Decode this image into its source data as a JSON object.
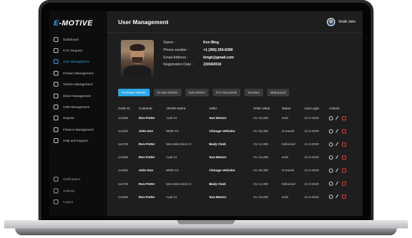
{
  "brand": {
    "prefix": "E",
    "name": "-MOTIVE"
  },
  "sidebar": {
    "items": [
      {
        "label": "Dashboard",
        "icon": "grid-icon"
      },
      {
        "label": "KYC Request",
        "icon": "shield-icon"
      },
      {
        "label": "User Management",
        "icon": "user-icon",
        "active": true
      },
      {
        "label": "Product Management",
        "icon": "box-icon"
      },
      {
        "label": "Vehicle Management",
        "icon": "car-icon"
      },
      {
        "label": "Driver Management",
        "icon": "driver-icon"
      },
      {
        "label": "CMS Management",
        "icon": "cms-icon"
      },
      {
        "label": "Reports",
        "icon": "report-icon"
      },
      {
        "label": "Finance Management",
        "icon": "finance-icon"
      },
      {
        "label": "Help and Support",
        "icon": "help-icon"
      }
    ],
    "bottom_items": [
      {
        "label": "Notifications",
        "icon": "bell-icon"
      },
      {
        "label": "Settings",
        "icon": "gear-icon"
      },
      {
        "label": "Logout",
        "icon": "logout-icon"
      }
    ]
  },
  "header": {
    "title": "User Management",
    "user_name": "Smith John"
  },
  "profile": {
    "name_label": "Name :",
    "name": "Ken Bing",
    "phone_label": "Phone number :",
    "phone": "+1 (365) 254-6398",
    "email_label": "Email Address :",
    "email": "bingk@gmail.com",
    "reg_label": "Registration Date :",
    "reg_date": "23/04/2018"
  },
  "tabs": [
    "Purchased vehicles",
    "On sale vehicles",
    "Sold vehicles",
    "KYC Documents",
    "Inventory",
    "Making pool"
  ],
  "table": {
    "headers": [
      "Order ID",
      "Customer",
      "Vehicle Name",
      "Seller",
      "Order Value",
      "Status",
      "Last Login",
      "Actions"
    ],
    "rows": [
      [
        "xxx365",
        "Ron Potter",
        "Audi A4",
        "Sun Motors",
        "CU 19,200",
        "Sold",
        "21-2-2020"
      ],
      [
        "xxx491",
        "John Doe",
        "BMW X3",
        "Chicago Vehicles",
        "CU 25,300",
        "In-transit",
        "21-2-2020"
      ],
      [
        "xxx728",
        "Ron Potter",
        "Mercedes Benz G",
        "Mady Clark",
        "CU 12,300",
        "Delivered",
        "21-2-2020"
      ],
      [
        "xxx365",
        "Ron Potter",
        "Audi A4",
        "Sun Motors",
        "CU 19,200",
        "Sold",
        "21-2-2020"
      ],
      [
        "xxx491",
        "John Doe",
        "BMW X3",
        "Chicago Vehicles",
        "CU 25,300",
        "In-transit",
        "21-2-2020"
      ],
      [
        "xxx728",
        "Ron Potter",
        "Mercedes Benz G",
        "Mady Clark",
        "CU 12,300",
        "Delivered",
        "21-2-2020"
      ],
      [
        "xxx365",
        "Ron Potter",
        "Audi A4",
        "Sun Motors",
        "CU 19,200",
        "Sold",
        "21-2-2020"
      ]
    ]
  },
  "colors": {
    "accent": "#2ba7e8",
    "delete": "#e53935",
    "background": "#1e1e1f",
    "sidebar": "#0d0d0e"
  }
}
